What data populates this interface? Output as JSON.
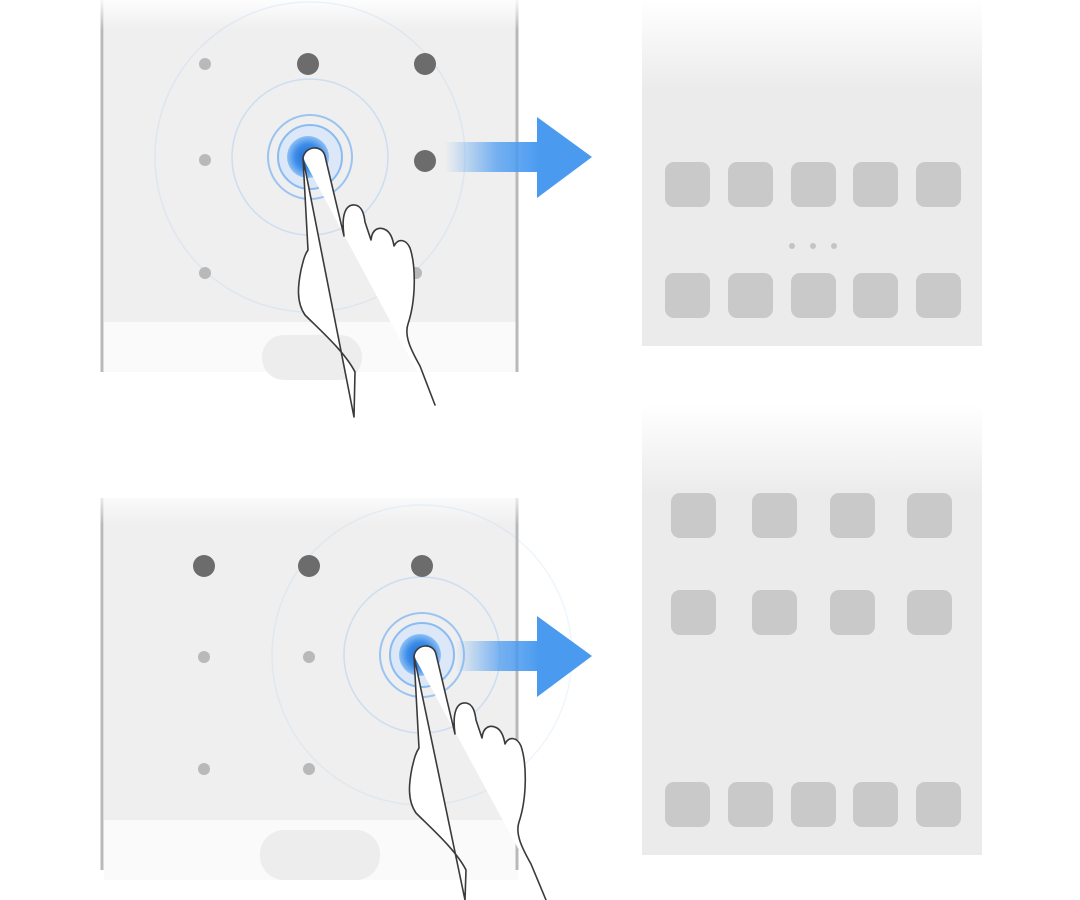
{
  "colors": {
    "background": "#ffffff",
    "phone_screen": "#efefef",
    "phone_frame": "#b9b9b9",
    "dot_active": "#6c6c6c",
    "dot_inactive": "#b9b9b9",
    "touch_blue": "#2f7fe6",
    "ring_blue": "#7fb6f2",
    "arrow_blue": "#4a9af0",
    "home_screen": "#ebebeb",
    "app_icon": "#c9c9c9",
    "hand_stroke": "#3a3a3a",
    "hand_fill": "#ffffff"
  },
  "panels": [
    {
      "name": "top",
      "pattern_grid": {
        "active": [
          [
            false,
            true,
            true
          ],
          [
            false,
            false,
            true
          ],
          [
            false,
            false,
            false
          ]
        ]
      },
      "touch_point": {
        "col": 1,
        "row": 1
      },
      "gesture_direction": "right",
      "result_screen": {
        "icon_rows": [
          5,
          5
        ],
        "page_indicator_dots": 3
      }
    },
    {
      "name": "bottom",
      "pattern_grid": {
        "active": [
          [
            true,
            true,
            true
          ],
          [
            false,
            false,
            false
          ],
          [
            false,
            false,
            false
          ]
        ]
      },
      "touch_point": {
        "col": 2,
        "row": 1
      },
      "gesture_direction": "right",
      "result_screen": {
        "icon_rows": [
          4,
          4,
          0,
          5
        ],
        "page_indicator_dots": 0
      }
    }
  ]
}
